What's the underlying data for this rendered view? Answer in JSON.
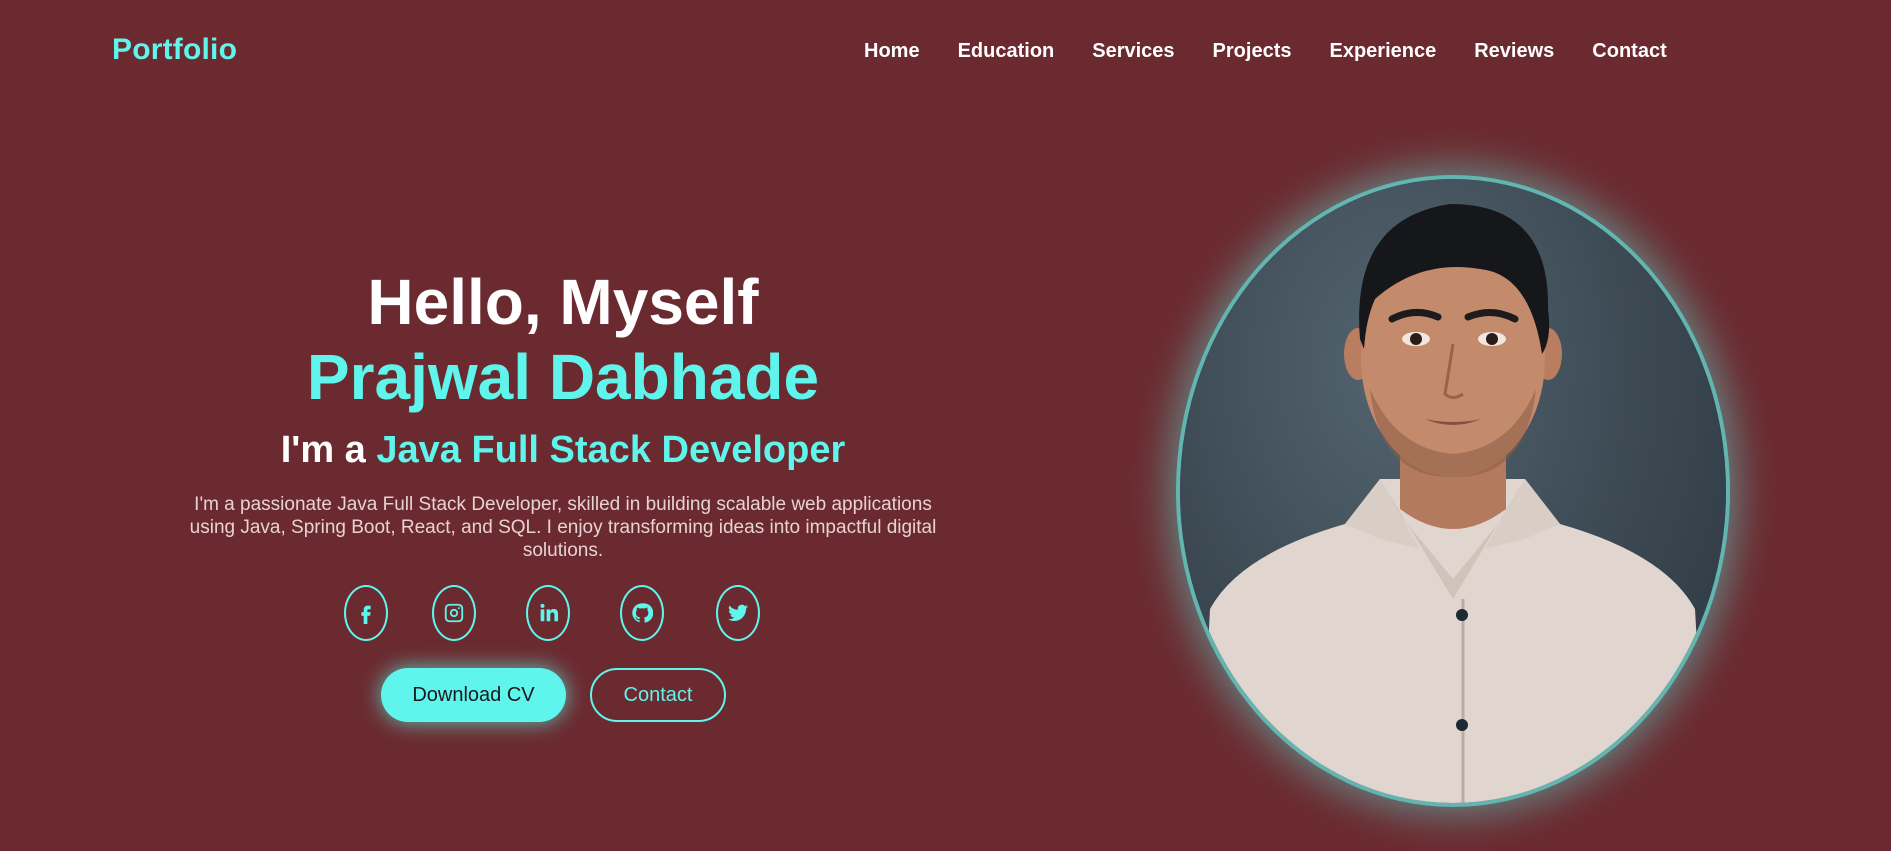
{
  "header": {
    "logo": "Portfolio",
    "nav": [
      "Home",
      "Education",
      "Services",
      "Projects",
      "Experience",
      "Reviews",
      "Contact"
    ]
  },
  "hero": {
    "greeting": "Hello, Myself",
    "name": "Prajwal Dabhade",
    "role_prefix": "I'm a",
    "role": "Java Full Stack Developer",
    "description": "I'm a passionate Java Full Stack Developer, skilled in building scalable web applications using Java, Spring Boot, React, and SQL. I enjoy transforming ideas into impactful digital solutions.",
    "socials": [
      "facebook-icon",
      "instagram-icon",
      "linkedin-icon",
      "github-icon",
      "twitter-icon"
    ],
    "buttons": {
      "download_cv": "Download CV",
      "contact": "Contact"
    }
  },
  "colors": {
    "background": "#6b2a2f",
    "accent": "#5ff5ec",
    "text": "#ffffff"
  }
}
